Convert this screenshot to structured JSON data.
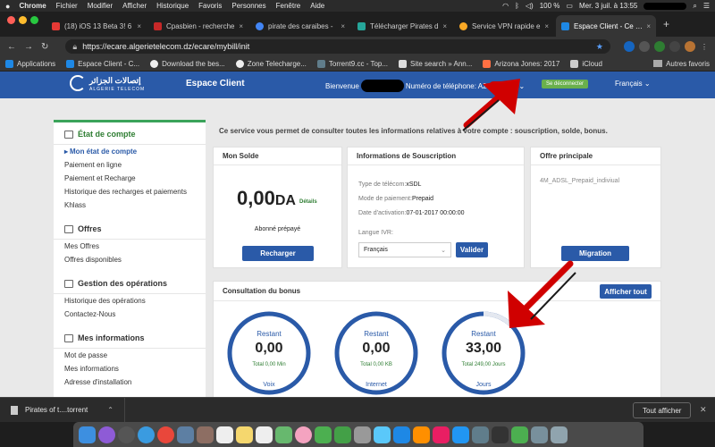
{
  "menubar": {
    "app": "Chrome",
    "items": [
      "Fichier",
      "Modifier",
      "Afficher",
      "Historique",
      "Favoris",
      "Personnes",
      "Fenêtre",
      "Aide"
    ],
    "battery": "100 %",
    "clock": "Mer. 3 juil. à 13:55"
  },
  "tabs": [
    {
      "title": "(18) iOS 13 Beta 3! 6",
      "color": "#e53935"
    },
    {
      "title": "Cpasbien - recherche",
      "color": "#c62828"
    },
    {
      "title": "pirate des caraibes -",
      "color": "#4285f4"
    },
    {
      "title": "Télécharger Pirates d",
      "color": "#26a69a"
    },
    {
      "title": "Service VPN rapide e",
      "color": "#f9a825"
    },
    {
      "title": "Espace Client - Ce se",
      "color": "#1e88e5"
    }
  ],
  "address": {
    "url": "https://ecare.algerietelecom.dz/ecare/mybill/init"
  },
  "bookmarks": {
    "items": [
      "Applications",
      "Espace Client - C...",
      "Download the bes...",
      "Zone Telecharge...",
      "Torrent9.cc - Top...",
      "Site search » Ann...",
      "Arizona Jones: 2017",
      "iCloud"
    ],
    "other": "Autres favoris"
  },
  "site": {
    "logo_ar": "إتصالات الجزائر",
    "logo_latin": "ALGERIE TELECOM",
    "title": "Espace Client",
    "welcome": "Bienvenue",
    "phone_label": "Numéro de téléphone: A2",
    "logout": "Se déconnecter",
    "language": "Français"
  },
  "sidebar": {
    "sections": [
      {
        "title": "État de compte",
        "items": [
          "Mon état de compte",
          "Paiement en ligne",
          "Paiement et Recharge",
          "Historique des recharges et paiements",
          "Khlass"
        ]
      },
      {
        "title": "Offres",
        "items": [
          "Mes Offres",
          "Offres disponibles"
        ]
      },
      {
        "title": "Gestion des opérations",
        "items": [
          "Historique des opérations",
          "Contactez-Nous"
        ]
      },
      {
        "title": "Mes informations",
        "items": [
          "Mot de passe",
          "Mes informations",
          "Adresse d'installation"
        ]
      }
    ]
  },
  "intro": "Ce service vous permet de consulter toutes les informations relatives à votre compte : souscription, solde, bonus.",
  "solde": {
    "title": "Mon Solde",
    "amount": "0,00",
    "currency": "DA",
    "details": "Détails",
    "subscription": "Abonné prépayé",
    "button": "Recharger"
  },
  "souscription": {
    "title": "Informations de Souscription",
    "phone_type_label": "Type de télécom:",
    "phone_type": "xSDL",
    "payment_label": "Mode de paiement:",
    "payment": "Prepaid",
    "activation_label": "Date d'activation:",
    "activation": "07-01-2017 00:00:00",
    "ivr_label": "Langue IVR:",
    "ivr_value": "Français",
    "button": "Valider"
  },
  "offre": {
    "title": "Offre principale",
    "value": "4M_ADSL_Prepaid_indiviual",
    "button": "Migration"
  },
  "bonus": {
    "title": "Consultation du bonus",
    "button": "Afficher tout",
    "gauges": [
      {
        "label": "Restant",
        "value": "0,00",
        "sub": "Total 0,00 Min",
        "name": "Voix",
        "fill": 0
      },
      {
        "label": "Restant",
        "value": "0,00",
        "sub": "Total 0,00 KB",
        "name": "Internet",
        "fill": 0
      },
      {
        "label": "Restant",
        "value": "33,00",
        "sub": "Total 249,00 Jours",
        "name": "Jours",
        "fill": 0.13
      }
    ]
  },
  "downloads": {
    "file": "Pirates of t....torrent",
    "show_all": "Tout afficher"
  },
  "colors": {
    "brand": "#2a5aa8",
    "green": "#3aa35a",
    "annotation": "#d00000"
  }
}
